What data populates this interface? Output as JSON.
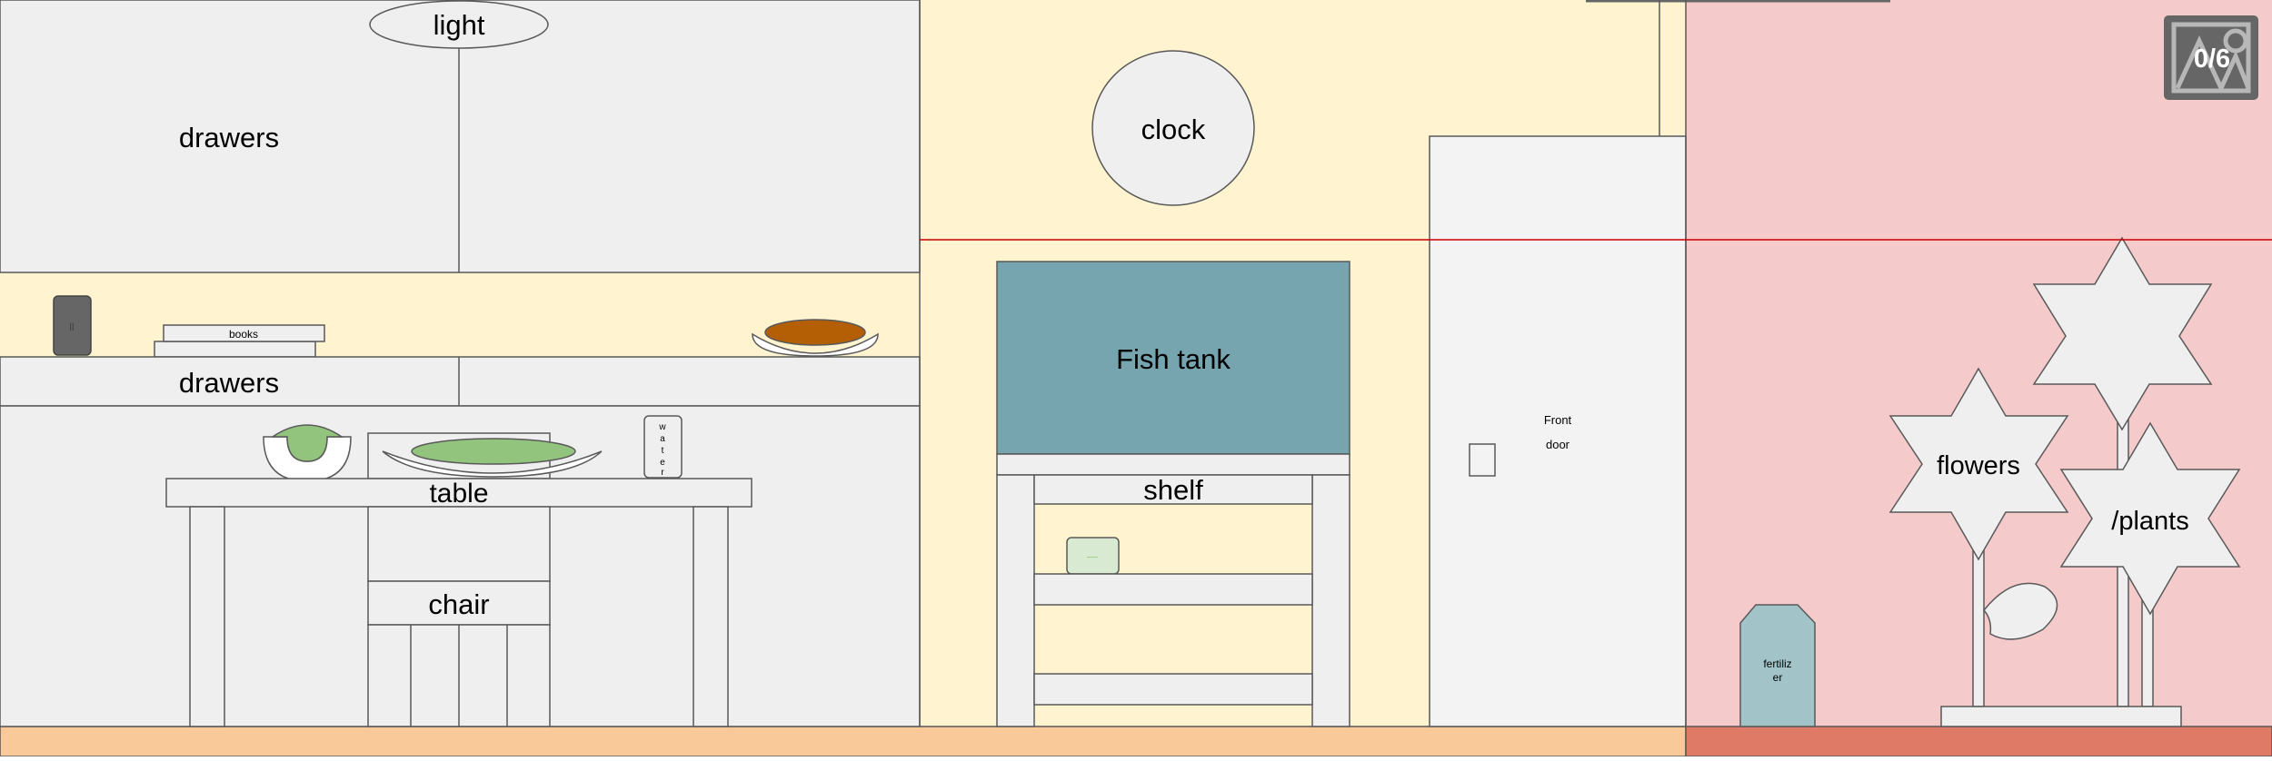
{
  "labels": {
    "light": "light",
    "drawers_top": "drawers",
    "drawers_mid": "drawers",
    "books": "books",
    "water": [
      "w",
      "a",
      "t",
      "e",
      "r"
    ],
    "table": "table",
    "chair": "chair",
    "clock": "clock",
    "fish_tank": "Fish tank",
    "shelf": "shelf",
    "front_door_line1": "Front",
    "front_door_line2": "door",
    "flowers": "flowers",
    "plants": "/plants",
    "fertilizer_line1": "fertiliz",
    "fertilizer_line2": "er",
    "speaker_mark": "||",
    "tank_item_mark": "~~~"
  },
  "counter": {
    "found": 0,
    "total": 6,
    "text": "0/6"
  },
  "colors": {
    "room_left": "#efefef",
    "room_middle": "#fff4cf",
    "room_right": "#f4cacb",
    "floor_left": "#f9c99a",
    "floor_right": "#df7a66",
    "fish_tank": "#76a5af",
    "fertilizer": "#a2c4c9",
    "soup": "#b45f06",
    "salad": "#93c47d",
    "speaker": "#666666",
    "guide_line": "#cc0000",
    "outline": "#595959"
  },
  "icons": {
    "counter": "image-icon"
  }
}
